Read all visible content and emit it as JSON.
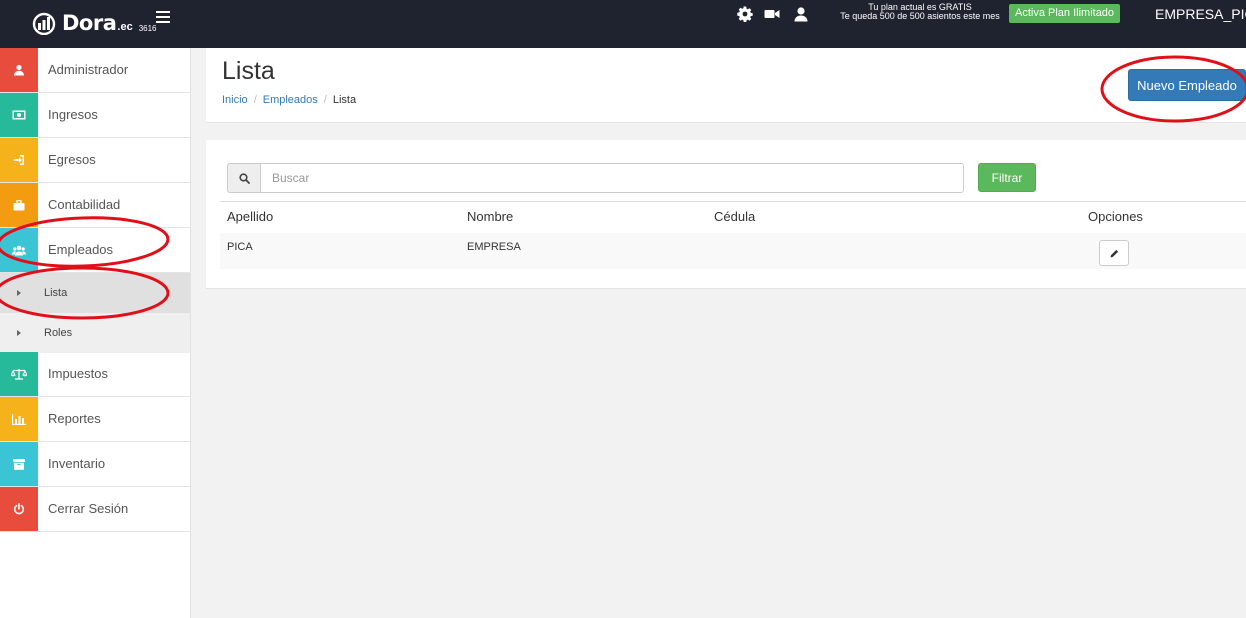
{
  "header": {
    "brand_name": "Dora",
    "brand_suffix": ".ec",
    "brand_number": "3616",
    "plan_line1": "Tu plan actual es GRATIS",
    "plan_line2": "Te queda 500 de 500 asientos este mes",
    "plan_button": "Activa Plan Ilimitado",
    "company": "EMPRESA_PIC"
  },
  "sidebar": {
    "items": [
      {
        "label": "Administrador",
        "icon": "user-icon",
        "color": "#e74c3c"
      },
      {
        "label": "Ingresos",
        "icon": "money-icon",
        "color": "#26b99a"
      },
      {
        "label": "Egresos",
        "icon": "sign-in-icon",
        "color": "#f5b21b"
      },
      {
        "label": "Contabilidad",
        "icon": "briefcase-icon",
        "color": "#f39c12"
      },
      {
        "label": "Empleados",
        "icon": "users-icon",
        "color": "#3bc4d4"
      },
      {
        "label": "Impuestos",
        "icon": "balance-scale-icon",
        "color": "#26b99a"
      },
      {
        "label": "Reportes",
        "icon": "bar-chart-icon",
        "color": "#f5b21b"
      },
      {
        "label": "Inventario",
        "icon": "archive-icon",
        "color": "#3bc4d4"
      },
      {
        "label": "Cerrar Sesión",
        "icon": "power-off-icon",
        "color": "#e74c3c"
      }
    ],
    "subitems": [
      {
        "label": "Lista"
      },
      {
        "label": "Roles"
      }
    ]
  },
  "page": {
    "title": "Lista",
    "breadcrumb": [
      "Inicio",
      "Empleados",
      "Lista"
    ],
    "new_button": "Nuevo Empleado"
  },
  "search": {
    "placeholder": "Buscar",
    "value": "",
    "filter_button": "Filtrar"
  },
  "table": {
    "columns": [
      "Apellido",
      "Nombre",
      "Cédula",
      "Opciones"
    ],
    "rows": [
      {
        "apellido": "PICA",
        "nombre": "EMPRESA",
        "cedula": ""
      }
    ]
  },
  "colors": {
    "topbar": "#1f2330",
    "primary": "#337ab7",
    "success": "#5cb85c",
    "annotation": "#e0101a"
  }
}
